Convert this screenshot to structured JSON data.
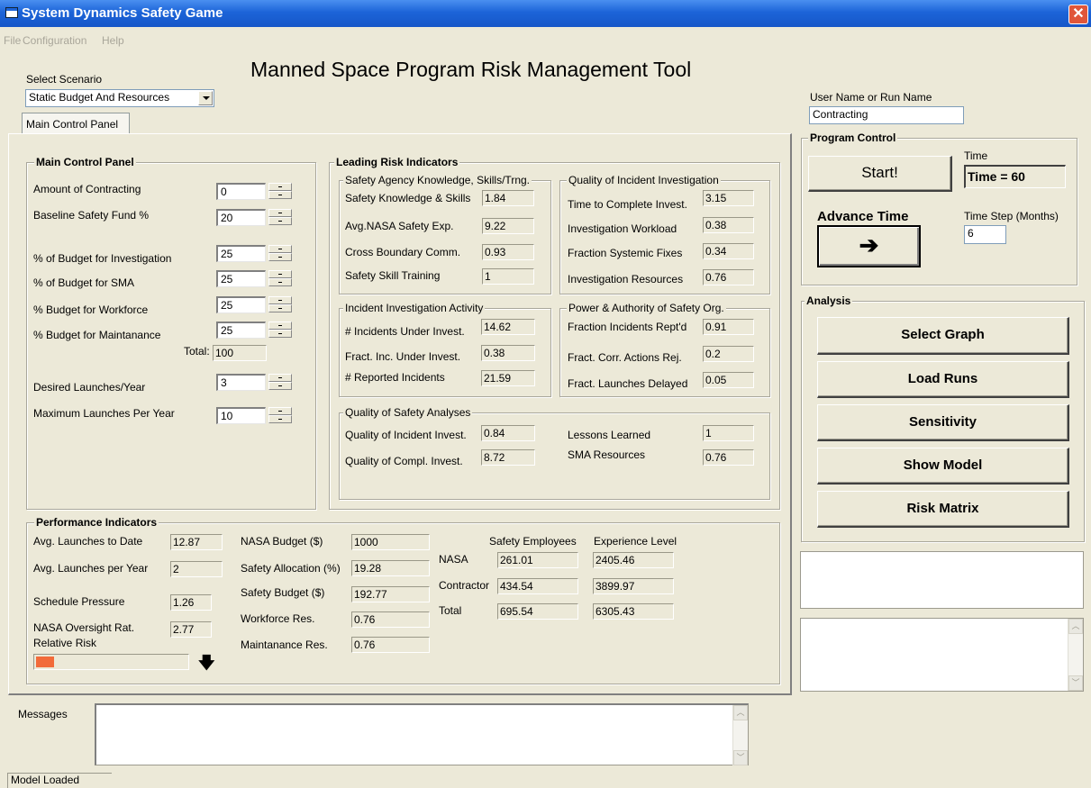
{
  "window": {
    "title": "System Dynamics Safety Game",
    "close_glyph": "✕"
  },
  "menu": {
    "file": "File",
    "configuration": "Configuration",
    "help": "Help"
  },
  "app_title": "Manned Space Program Risk Management Tool",
  "scenario": {
    "label": "Select Scenario",
    "value": "Static Budget And Resources"
  },
  "tab": {
    "label": "Main Control Panel"
  },
  "main_control": {
    "title": "Main Control Panel",
    "contracting": {
      "label": "Amount of Contracting",
      "value": "0"
    },
    "baseline_fund": {
      "label": "Baseline Safety Fund %",
      "value": "20"
    },
    "budget_investigation": {
      "label": "% of Budget for Investigation",
      "value": "25"
    },
    "budget_sma": {
      "label": "% of Budget for SMA",
      "value": "25"
    },
    "budget_workforce": {
      "label": "% Budget for Workforce",
      "value": "25"
    },
    "budget_maintenance": {
      "label": "% Budget for Maintanance",
      "value": "25"
    },
    "total": {
      "label": "Total:",
      "value": "100"
    },
    "desired_launches": {
      "label": "Desired Launches/Year",
      "value": "3"
    },
    "max_launches": {
      "label": "Maximum Launches Per Year",
      "value": "10"
    }
  },
  "leading": {
    "title": "Leading Risk Indicators",
    "knowledge": {
      "title": "Safety Agency Knowledge, Skills/Trng.",
      "rows": [
        {
          "label": "Safety Knowledge & Skills",
          "value": "1.84"
        },
        {
          "label": "Avg.NASA Safety Exp.",
          "value": "9.22"
        },
        {
          "label": "Cross Boundary Comm.",
          "value": "0.93"
        },
        {
          "label": "Safety Skill Training",
          "value": "1"
        }
      ]
    },
    "quality_investigation": {
      "title": "Quality of Incident Investigation",
      "rows": [
        {
          "label": "Time to Complete Invest.",
          "value": "3.15"
        },
        {
          "label": "Investigation Workload",
          "value": "0.38"
        },
        {
          "label": "Fraction Systemic Fixes",
          "value": "0.34"
        },
        {
          "label": "Investigation Resources",
          "value": "0.76"
        }
      ]
    },
    "incident_activity": {
      "title": "Incident Investigation Activity",
      "rows": [
        {
          "label": "# Incidents Under Invest.",
          "value": "14.62"
        },
        {
          "label": "Fract. Inc. Under Invest.",
          "value": "0.38"
        },
        {
          "label": "# Reported Incidents",
          "value": "21.59"
        }
      ]
    },
    "power_authority": {
      "title": "Power & Authority of Safety Org.",
      "rows": [
        {
          "label": "Fraction Incidents Rept'd",
          "value": "0.91"
        },
        {
          "label": "Fract. Corr. Actions Rej.",
          "value": "0.2"
        },
        {
          "label": "Fract. Launches Delayed",
          "value": "0.05"
        }
      ]
    },
    "quality_analyses": {
      "title": "Quality of Safety Analyses",
      "incident_invest": {
        "label": "Quality of Incident Invest.",
        "value": "0.84"
      },
      "compl_invest": {
        "label": "Quality of Compl. Invest.",
        "value": "8.72"
      },
      "lessons": {
        "label": "Lessons Learned",
        "value": "1"
      },
      "sma": {
        "label": "SMA Resources",
        "value": "0.76"
      }
    }
  },
  "performance": {
    "title": "Performance Indicators",
    "avg_launches_date": {
      "label": "Avg. Launches to Date",
      "value": "12.87"
    },
    "avg_launches_year": {
      "label": "Avg. Launches per Year",
      "value": "2"
    },
    "schedule_pressure": {
      "label": "Schedule Pressure",
      "value": "1.26"
    },
    "oversight": {
      "label": "NASA Oversight Rat.",
      "value": "2.77"
    },
    "relative_risk": {
      "label": "Relative Risk",
      "level": 0.12,
      "color": "#f26b3a",
      "arrow_icon": "arrow-down-icon"
    },
    "nasa_budget": {
      "label": "NASA Budget ($)",
      "value": "1000"
    },
    "safety_allocation": {
      "label": "Safety Allocation (%)",
      "value": "19.28"
    },
    "safety_budget": {
      "label": "Safety Budget ($)",
      "value": "192.77"
    },
    "workforce_res": {
      "label": "Workforce Res.",
      "value": "0.76"
    },
    "maintenance_res": {
      "label": "Maintanance Res.",
      "value": "0.76"
    },
    "employees": {
      "col_safety": "Safety Employees",
      "col_experience": "Experience Level",
      "nasa": {
        "label": "NASA",
        "safety": "261.01",
        "experience": "2405.46"
      },
      "contractor": {
        "label": "Contractor",
        "safety": "434.54",
        "experience": "3899.97"
      },
      "total": {
        "label": "Total",
        "safety": "695.54",
        "experience": "6305.43"
      }
    }
  },
  "user": {
    "label": "User Name or Run Name",
    "value": "Contracting"
  },
  "program_control": {
    "title": "Program Control",
    "start": "Start!",
    "time_label": "Time",
    "time_value": "Time = 60",
    "advance_label": "Advance Time",
    "advance_glyph": "➔",
    "step_label": "Time Step (Months)",
    "step_value": "6"
  },
  "analysis": {
    "title": "Analysis",
    "select_graph": "Select Graph",
    "load_runs": "Load Runs",
    "sensitivity": "Sensitivity",
    "show_model": "Show Model",
    "risk_matrix": "Risk  Matrix"
  },
  "messages": {
    "label": "Messages",
    "value": ""
  },
  "status": {
    "text": "Model Loaded"
  },
  "glyphs": {
    "up": "︿",
    "down": "﹀",
    "arrow_down": "🡇"
  }
}
